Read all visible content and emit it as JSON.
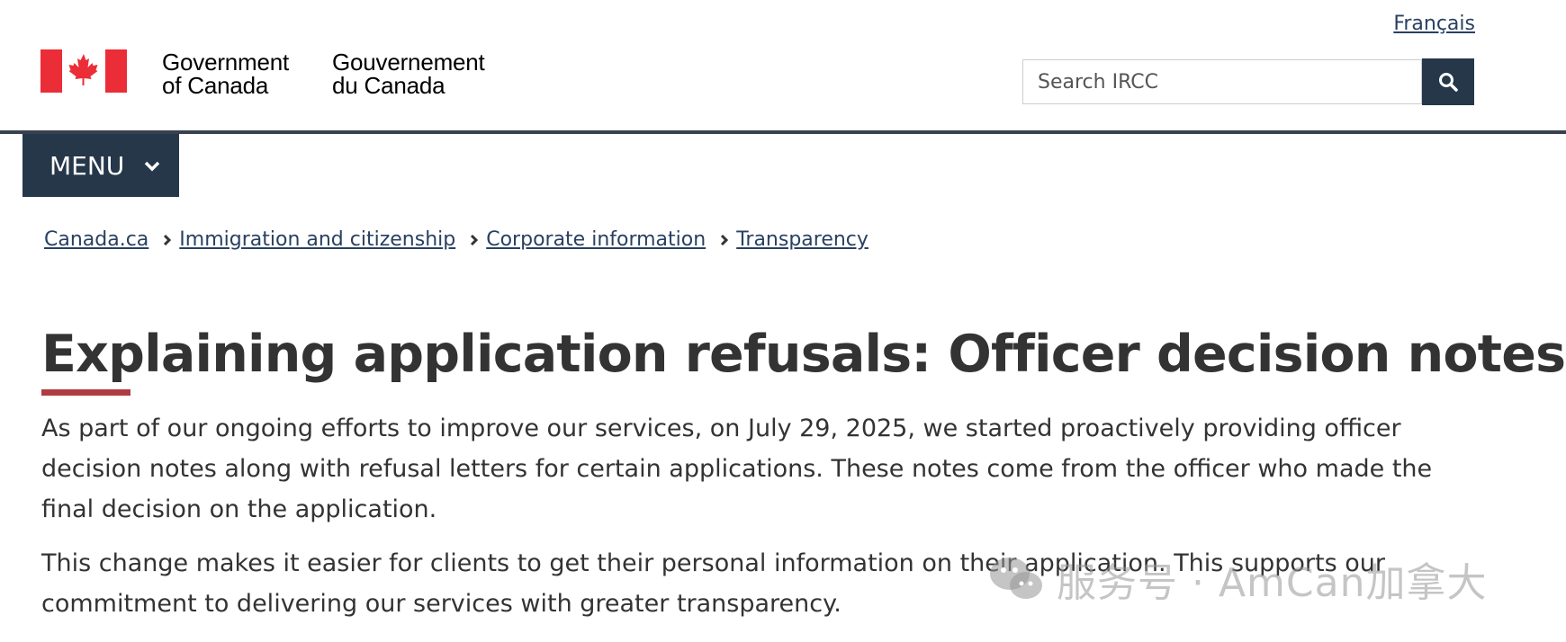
{
  "header": {
    "language_link": "Français",
    "signature": {
      "en_line1": "Government",
      "en_line2": "of Canada",
      "fr_line1": "Gouvernement",
      "fr_line2": "du Canada"
    },
    "search": {
      "placeholder": "Search IRCC",
      "button_icon": "magnifier-icon"
    },
    "colors": {
      "brand_dark": "#26374a",
      "flag_red": "#eb2d37",
      "accent": "#af3c43",
      "link": "#284162"
    }
  },
  "menu": {
    "label": "MENU"
  },
  "breadcrumb": [
    {
      "label": "Canada.ca"
    },
    {
      "label": "Immigration and citizenship"
    },
    {
      "label": "Corporate information"
    },
    {
      "label": "Transparency"
    }
  ],
  "main": {
    "title": "Explaining application refusals: Officer decision notes",
    "paragraphs": [
      "As part of our ongoing efforts to improve our services, on July 29, 2025, we started proactively providing officer decision notes along with refusal letters for certain applications. These notes come from the officer who made the final decision on the application.",
      "This change makes it easier for clients to get their personal information on their application. This supports our commitment to delivering our services with greater transparency."
    ]
  },
  "watermark": {
    "text": "服务号 · AmCan加拿大"
  }
}
